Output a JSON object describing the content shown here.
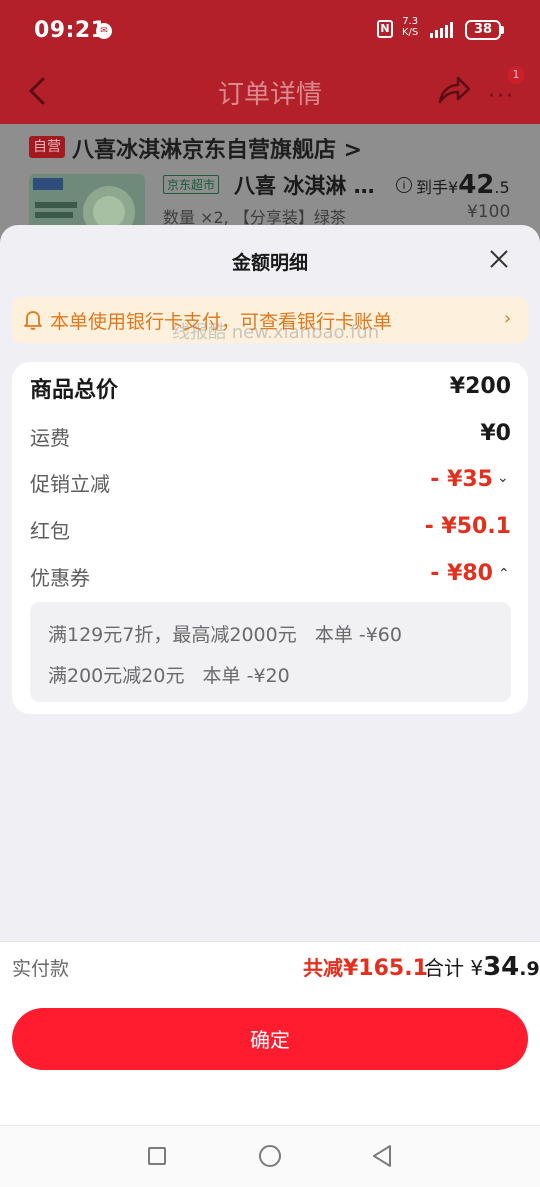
{
  "status_bar": {
    "time": "09:21",
    "speed_value": "7.3",
    "speed_unit": "K/S",
    "battery": "38"
  },
  "header": {
    "title": "订单详情",
    "badge": "1"
  },
  "order": {
    "self_operated_tag": "自营",
    "store_name": "八喜冰淇淋京东自营旗舰店 >",
    "jd_tag": "京东超市",
    "product_name": "八喜 冰淇淋 …",
    "final_price_prefix": "到手¥",
    "final_price_int": "42",
    "final_price_dec": ".5",
    "quantity_spec": "数量 ×2, 【分享装】绿茶",
    "original_price": "¥100"
  },
  "sheet": {
    "title": "金额明细",
    "notice": "本单使用银行卡支付，可查看银行卡账单",
    "watermark": "线报酷 new.xianbao.fun",
    "rows": {
      "total_label": "商品总价",
      "total_value": "¥200",
      "shipping_label": "运费",
      "shipping_value": "¥0",
      "promo_label": "促销立减",
      "promo_value": "- ¥35",
      "redpacket_label": "红包",
      "redpacket_value": "- ¥50.1",
      "coupon_label": "优惠券",
      "coupon_value": "- ¥80"
    },
    "coupon_details": [
      "满129元7折，最高减2000元   本单 -¥60",
      "满200元减20元   本单 -¥20"
    ]
  },
  "footer": {
    "pay_label": "实付款",
    "discount_prefix": "共减",
    "discount_value": "¥165.1",
    "sum_prefix": "合计 ¥",
    "sum_int": "34",
    "sum_dec": ".9",
    "confirm_label": "确定"
  },
  "colors": {
    "accent_red": "#fe1c2e",
    "discount_red": "#e22f1e",
    "notice_orange": "#e1781c"
  }
}
